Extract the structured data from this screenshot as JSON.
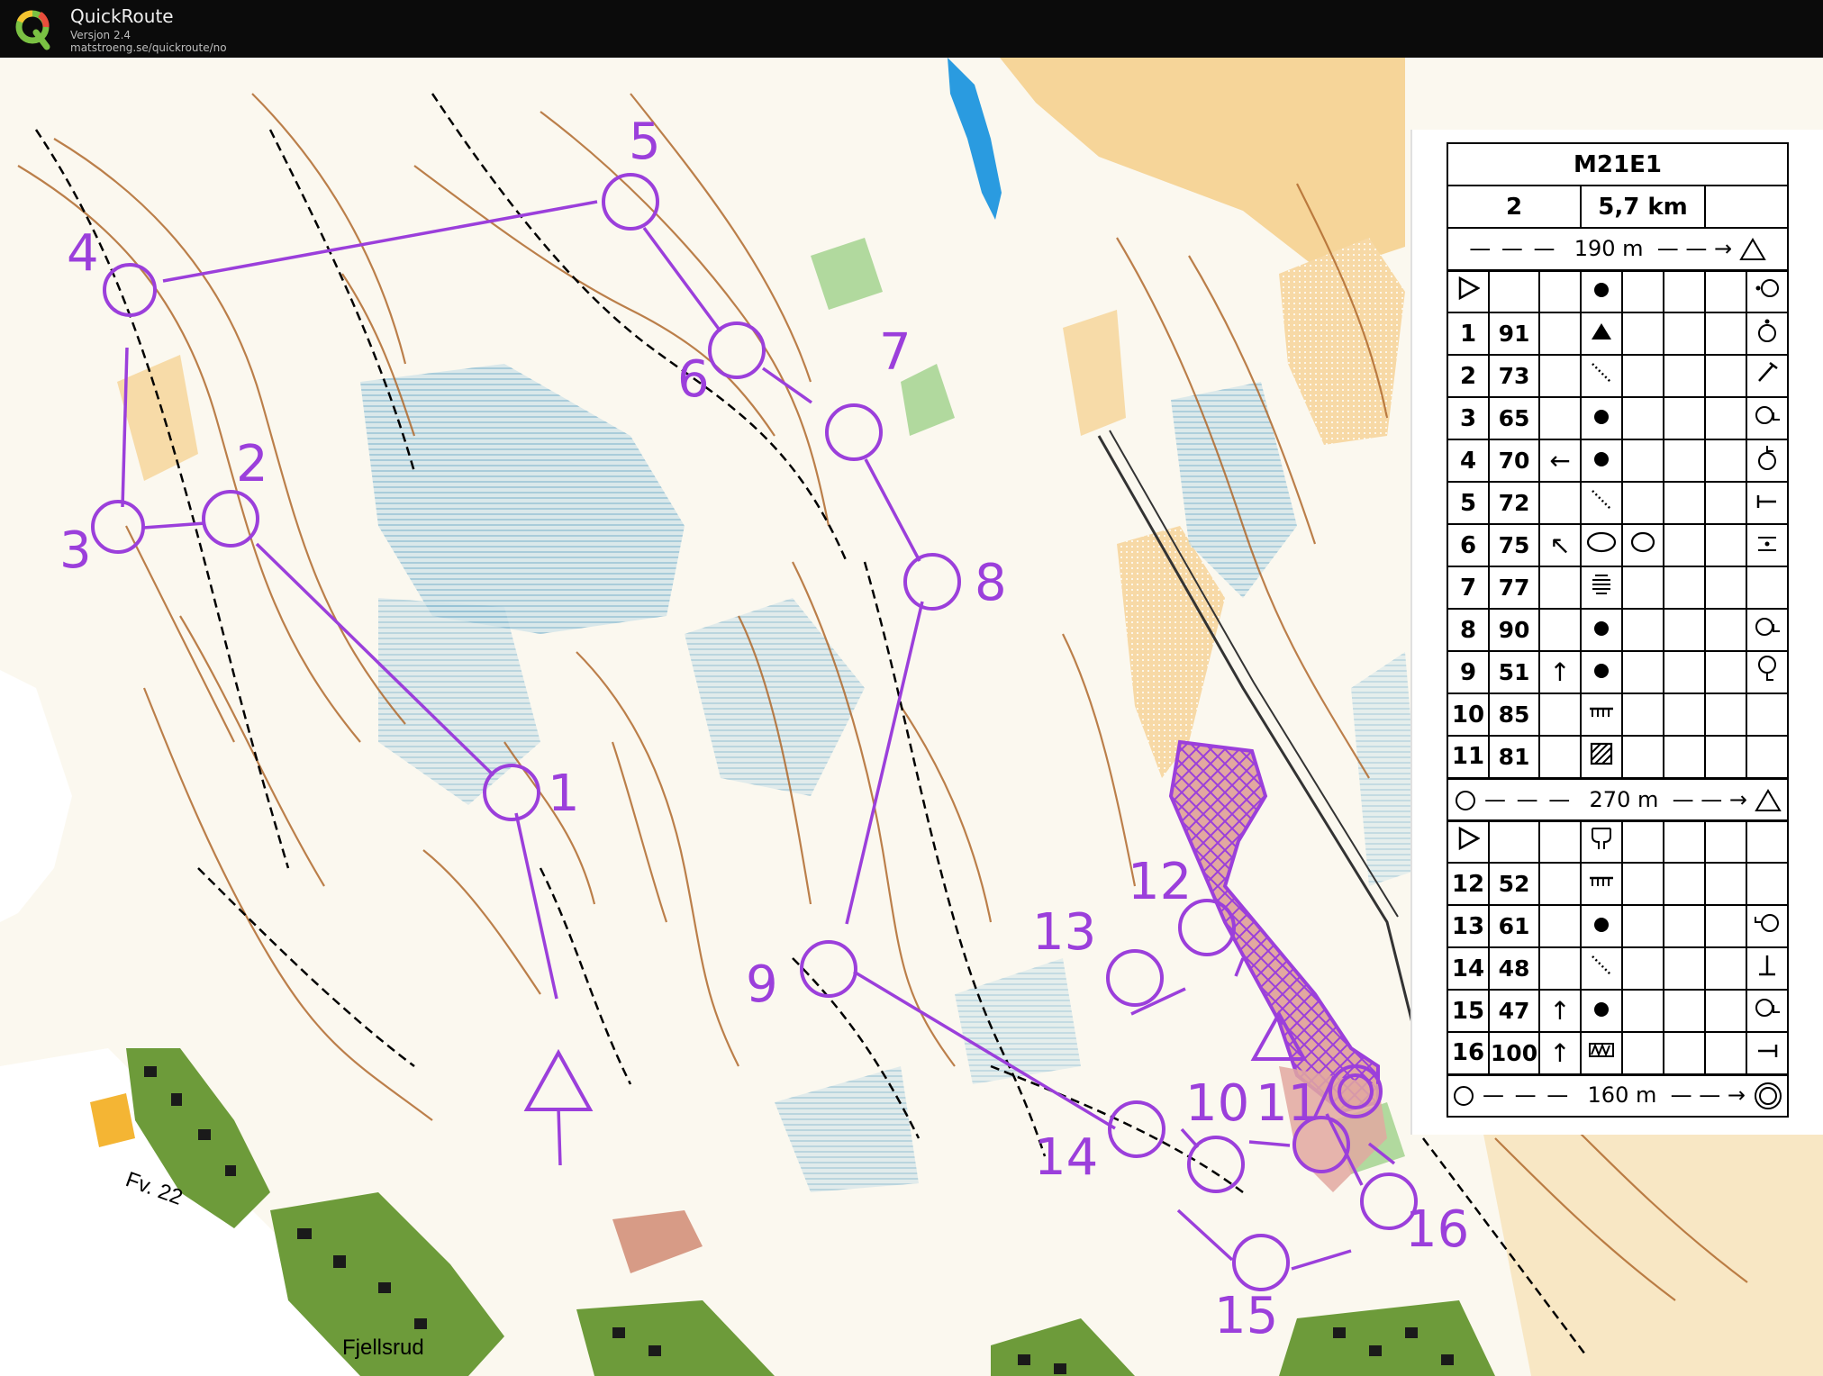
{
  "app": {
    "name": "QuickRoute",
    "version": "Versjon 2.4",
    "url": "matstroeng.se/quickroute/no"
  },
  "map": {
    "place_labels": {
      "road": "Fv. 22",
      "village": "Fjellsrud"
    },
    "course_color": "#9b3fdb",
    "controls": [
      {
        "label": "1"
      },
      {
        "label": "2"
      },
      {
        "label": "3"
      },
      {
        "label": "4"
      },
      {
        "label": "5"
      },
      {
        "label": "6"
      },
      {
        "label": "7"
      },
      {
        "label": "8"
      },
      {
        "label": "9"
      },
      {
        "label": "10"
      },
      {
        "label": "11"
      },
      {
        "label": "12"
      },
      {
        "label": "13"
      },
      {
        "label": "14"
      },
      {
        "label": "15"
      },
      {
        "label": "16"
      }
    ]
  },
  "control_description": {
    "class": "M21E1",
    "course": "2",
    "length": "5,7 km",
    "taped_route_1": "190 m",
    "taped_route_2": "270 m",
    "finish_distance": "160 m",
    "rows": [
      {
        "no": "1",
        "code": "91",
        "dir": "",
        "feature": "knoll",
        "appearance": "",
        "position": "top"
      },
      {
        "no": "2",
        "code": "73",
        "dir": "",
        "feature": "path-dots",
        "appearance": "",
        "position": "end"
      },
      {
        "no": "3",
        "code": "65",
        "dir": "",
        "feature": "dot",
        "appearance": "",
        "position": "east-foot"
      },
      {
        "no": "4",
        "code": "70",
        "dir": "←",
        "feature": "dot",
        "appearance": "",
        "position": "north-top"
      },
      {
        "no": "5",
        "code": "72",
        "dir": "",
        "feature": "path-dots",
        "appearance": "",
        "position": "bend"
      },
      {
        "no": "6",
        "code": "75",
        "dir": "↖",
        "feature": "oval",
        "appearance": "oval",
        "position": "middle"
      },
      {
        "no": "7",
        "code": "77",
        "dir": "",
        "feature": "marsh",
        "appearance": "",
        "position": ""
      },
      {
        "no": "8",
        "code": "90",
        "dir": "",
        "feature": "dot",
        "appearance": "",
        "position": "east-foot"
      },
      {
        "no": "9",
        "code": "51",
        "dir": "↑",
        "feature": "dot",
        "appearance": "",
        "position": "south-foot"
      },
      {
        "no": "10",
        "code": "85",
        "dir": "",
        "feature": "fence",
        "appearance": "",
        "position": ""
      },
      {
        "no": "11",
        "code": "81",
        "dir": "",
        "feature": "hatched",
        "appearance": "",
        "position": ""
      },
      {
        "no": "12",
        "code": "52",
        "dir": "",
        "feature": "fence",
        "appearance": "",
        "position": ""
      },
      {
        "no": "13",
        "code": "61",
        "dir": "",
        "feature": "dot",
        "appearance": "",
        "position": "west-foot"
      },
      {
        "no": "14",
        "code": "48",
        "dir": "",
        "feature": "path-dots",
        "appearance": "",
        "position": "end-bottom"
      },
      {
        "no": "15",
        "code": "47",
        "dir": "↑",
        "feature": "dot",
        "appearance": "",
        "position": "east-foot"
      },
      {
        "no": "16",
        "code": "100",
        "dir": "↑",
        "feature": "wall",
        "appearance": "",
        "position": "bend"
      }
    ]
  }
}
